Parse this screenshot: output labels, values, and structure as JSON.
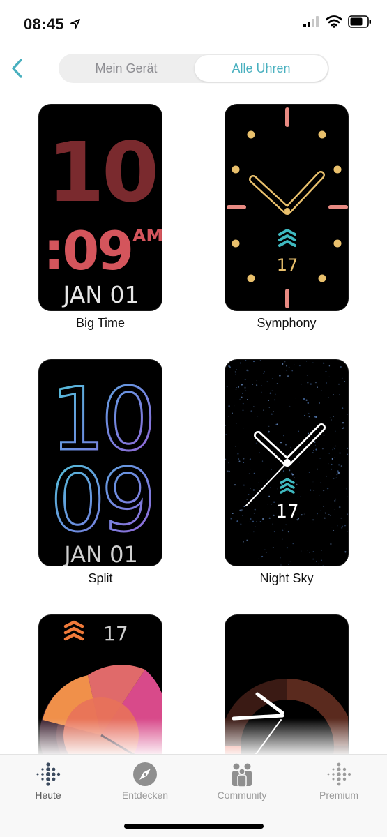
{
  "status_bar": {
    "time": "08:45"
  },
  "header": {
    "segments": [
      {
        "label": "Mein Gerät",
        "selected": false
      },
      {
        "label": "Alle Uhren",
        "selected": true
      }
    ],
    "accent_color": "#49b0bf"
  },
  "faces": {
    "big_time": {
      "name": "Big Time",
      "hour": "10",
      "minute": ":09",
      "ampm": "AM",
      "date": "JAN 01"
    },
    "symphony": {
      "name": "Symphony",
      "steps": "17"
    },
    "split": {
      "name": "Split",
      "hour": "10",
      "minute": "09",
      "date": "JAN 01"
    },
    "night_sky": {
      "name": "Night Sky",
      "steps": "17"
    },
    "face5": {
      "steps": "17"
    }
  },
  "tabbar": {
    "items": [
      {
        "label": "Heute",
        "icon": "fitbit-dots-icon",
        "active": true
      },
      {
        "label": "Entdecken",
        "icon": "compass-icon",
        "active": false
      },
      {
        "label": "Community",
        "icon": "community-icon",
        "active": false
      },
      {
        "label": "Premium",
        "icon": "premium-dots-icon",
        "active": false
      }
    ]
  }
}
